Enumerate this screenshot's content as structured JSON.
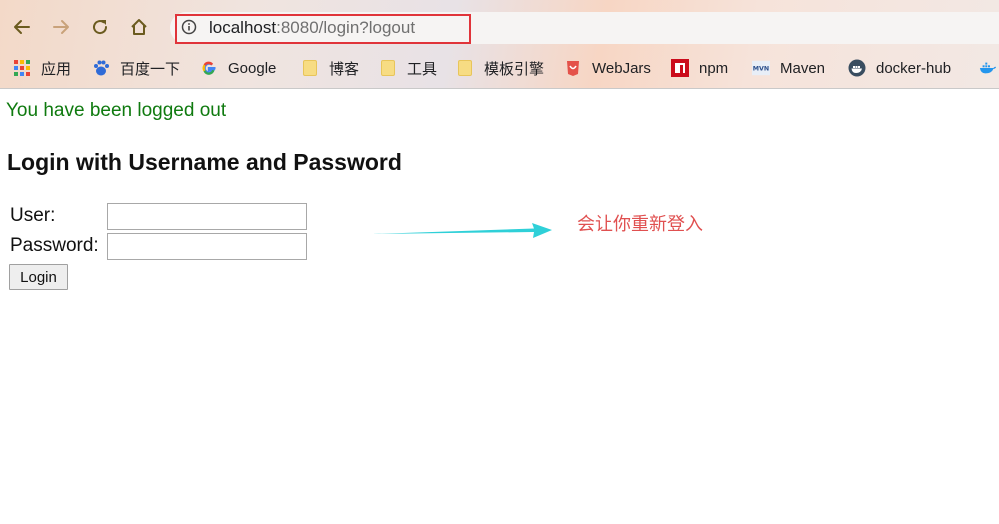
{
  "browser": {
    "url_host": "localhost",
    "url_rest": ":8080/login?logout",
    "bookmarks": [
      {
        "label": "应用",
        "icon": "apps-grid-icon"
      },
      {
        "label": "百度一下",
        "icon": "baidu-paw-icon"
      },
      {
        "label": "Google",
        "icon": "google-g-icon"
      },
      {
        "label": "博客",
        "icon": "folder-icon"
      },
      {
        "label": "工具",
        "icon": "folder-icon"
      },
      {
        "label": "模板引擎",
        "icon": "folder-icon"
      },
      {
        "label": "WebJars",
        "icon": "webjars-icon"
      },
      {
        "label": "npm",
        "icon": "npm-icon"
      },
      {
        "label": "Maven",
        "icon": "maven-icon"
      },
      {
        "label": "docker-hub",
        "icon": "docker-icon"
      }
    ]
  },
  "page": {
    "logout_message": "You have been logged out",
    "title": "Login with Username and Password",
    "form": {
      "user_label": "User:",
      "user_value": "",
      "password_label": "Password:",
      "password_value": "",
      "submit_label": "Login"
    }
  },
  "annotation": {
    "text": "会让你重新登入",
    "color": "#e05050"
  },
  "colors": {
    "highlight_box": "#e0343a",
    "logout_text": "#0f7a0f",
    "arrow": "#2fd0d8"
  }
}
